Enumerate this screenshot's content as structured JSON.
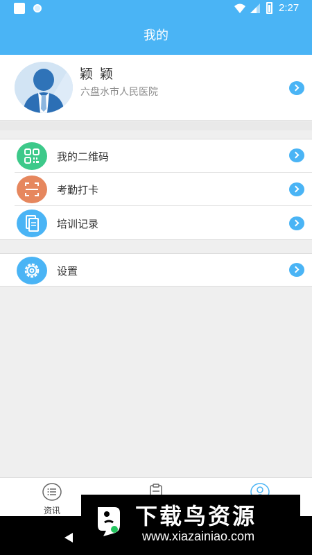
{
  "status_bar": {
    "time": "2:27",
    "icons": [
      "notification-square-icon",
      "sync-dot-icon",
      "wifi-icon",
      "signal-icon",
      "battery-charging-icon"
    ]
  },
  "header": {
    "title": "我的"
  },
  "profile": {
    "name": "颖 颖",
    "organization": "六盘水市人民医院",
    "avatar_icon": "user-avatar-icon"
  },
  "menu_group_1": [
    {
      "label": "我的二维码",
      "icon": "qr-code-icon",
      "color": "#3dc98a"
    },
    {
      "label": "考勤打卡",
      "icon": "scan-icon",
      "color": "#e6875e"
    },
    {
      "label": "培训记录",
      "icon": "document-icon",
      "color": "#4ab4f5"
    }
  ],
  "menu_group_2": [
    {
      "label": "设置",
      "icon": "gear-icon",
      "color": "#4ab4f5"
    }
  ],
  "bottom_nav": [
    {
      "label": "资讯",
      "icon": "list-icon"
    },
    {
      "label": "",
      "icon": "clipboard-icon"
    },
    {
      "label": "",
      "icon": "user-icon"
    }
  ],
  "watermark": {
    "title": "下载鸟资源",
    "url": "www.xiazainiao.com"
  },
  "colors": {
    "accent": "#4ab4f5",
    "background": "#efefef"
  }
}
